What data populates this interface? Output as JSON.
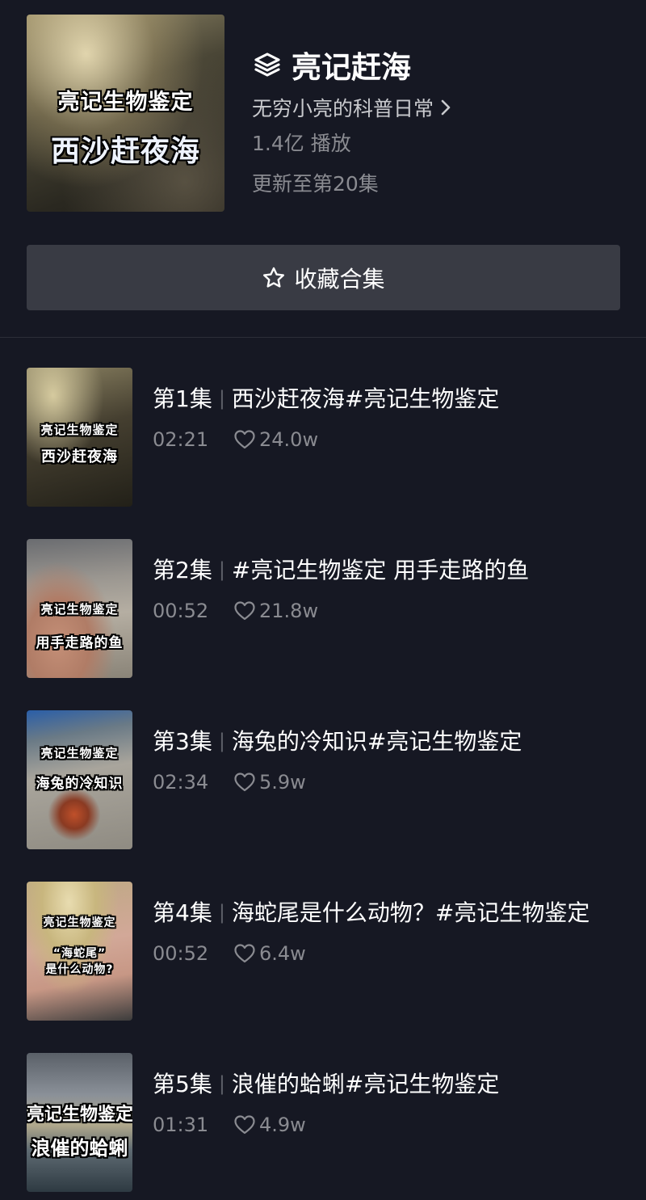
{
  "collection": {
    "title": "亮记赶海",
    "author": "无穷小亮的科普日常",
    "plays": "1.4亿 播放",
    "updated": "更新至第20集",
    "cover_line1": "亮记生物鉴定",
    "cover_line2": "西沙赶夜海",
    "favorite_label": "收藏合集",
    "icons": {
      "title": "layers-icon",
      "author": "chevron-right-icon",
      "favorite": "star-icon",
      "likes": "heart-icon"
    }
  },
  "episodes": [
    {
      "num": "第1集",
      "sep": "|",
      "title": "西沙赶夜海#亮记生物鉴定",
      "duration": "02:21",
      "likes": "24.0w",
      "cover_line1": "亮记生物鉴定",
      "cover_line2": "西沙赶夜海"
    },
    {
      "num": "第2集",
      "sep": "|",
      "title": "#亮记生物鉴定 用手走路的鱼",
      "duration": "00:52",
      "likes": "21.8w",
      "cover_line1": "亮记生物鉴定",
      "cover_line2": "用手走路的鱼"
    },
    {
      "num": "第3集",
      "sep": "|",
      "title": "海兔的冷知识#亮记生物鉴定",
      "duration": "02:34",
      "likes": "5.9w",
      "cover_line1": "亮记生物鉴定",
      "cover_line2": "海兔的冷知识"
    },
    {
      "num": "第4集",
      "sep": "|",
      "title": "海蛇尾是什么动物？#亮记生物鉴定",
      "duration": "00:52",
      "likes": "6.4w",
      "cover_line1": "亮记生物鉴定",
      "cover_line2": "“海蛇尾”",
      "cover_line3": "是什么动物?"
    },
    {
      "num": "第5集",
      "sep": "|",
      "title": "浪催的蛤蜊#亮记生物鉴定",
      "duration": "01:31",
      "likes": "4.9w",
      "cover_line1": "亮记生物鉴定",
      "cover_line2": "浪催的蛤蜊"
    }
  ],
  "colors": {
    "background": "#161823",
    "button": "#393b44",
    "secondary_text": "#8a8b91"
  }
}
